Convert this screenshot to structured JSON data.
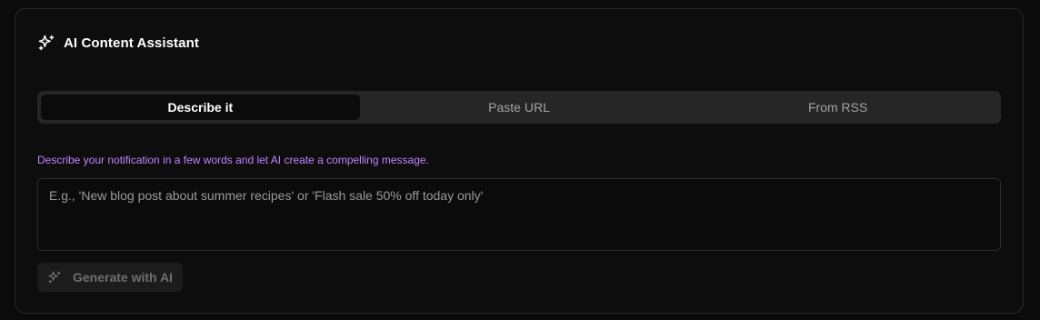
{
  "header": {
    "icon": "sparkles-icon",
    "title": "AI Content Assistant"
  },
  "tabs": [
    {
      "label": "Describe it",
      "active": true
    },
    {
      "label": "Paste URL",
      "active": false
    },
    {
      "label": "From RSS",
      "active": false
    }
  ],
  "describe": {
    "hint": "Describe your notification in a few words and let AI create a compelling message.",
    "placeholder": "E.g., 'New blog post about summer recipes' or 'Flash sale 50% off today only'",
    "value": ""
  },
  "generate_button": {
    "icon": "sparkles-icon",
    "label": "Generate with AI",
    "disabled": true
  },
  "colors": {
    "background": "#0b0b0b",
    "accent_hint": "#c084fc",
    "tab_bar": "#262626"
  }
}
